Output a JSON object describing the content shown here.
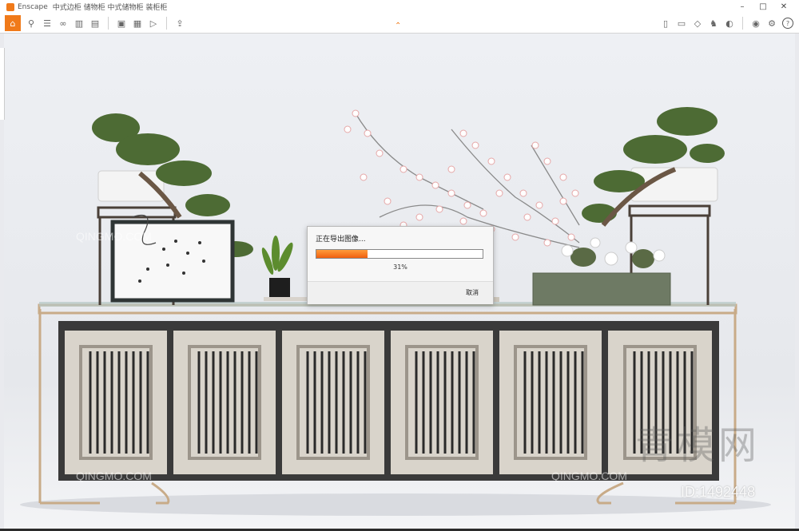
{
  "window": {
    "app_name": "Enscape",
    "document_title": "中式边柜 储物柜 中式储物柜 装柜柜",
    "controls": [
      "–",
      "□",
      "✕"
    ]
  },
  "toolbar": {
    "left_icons": [
      "home-icon",
      "pin-icon",
      "layers-icon",
      "binoculars-icon",
      "buildings-icon",
      "graph-icon",
      "screenshot-icon",
      "panorama-icon",
      "video-icon",
      "export-icon"
    ],
    "right_icons": [
      "book-icon",
      "monitor-icon",
      "cube-icon",
      "asset-icon",
      "visual-settings-icon",
      "eye-icon",
      "gear-icon",
      "help-icon"
    ],
    "help_label": "?"
  },
  "dialog": {
    "title": "正在导出图像...",
    "progress_percent": 31,
    "progress_label": "31%",
    "cancel_label": "取消"
  },
  "watermark": {
    "brand": "青模网",
    "site": "QINGMO.COM",
    "id_label": "ID:1492448"
  },
  "colors": {
    "accent": "#f07a1a",
    "progress": "#f06010",
    "cabinet_frame": "#c8ab88"
  }
}
